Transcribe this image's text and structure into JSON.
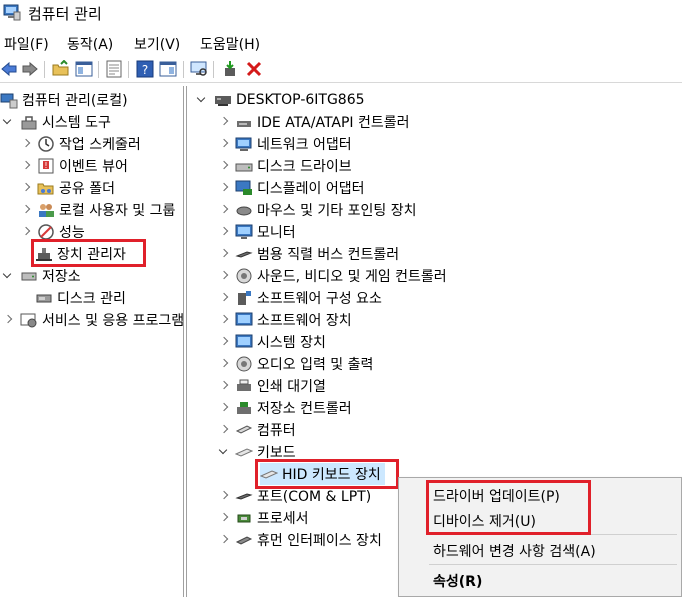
{
  "window": {
    "title": "컴퓨터 관리"
  },
  "menu": [
    "파일(F)",
    "동작(A)",
    "보기(V)",
    "도움말(H)"
  ],
  "left_tree": {
    "root": "컴퓨터 관리(로컬)",
    "system_tools": "시스템 도구",
    "task_scheduler": "작업 스케줄러",
    "event_viewer": "이벤트 뷰어",
    "shared_folders": "공유 폴더",
    "local_users": "로컬 사용자 및 그룹",
    "performance": "성능",
    "device_manager": "장치 관리자",
    "storage": "저장소",
    "disk_management": "디스크 관리",
    "services": "서비스 및 응용 프로그램"
  },
  "device_tree": {
    "computer": "DESKTOP-6ITG865",
    "categories": [
      "IDE ATA/ATAPI 컨트롤러",
      "네트워크 어댑터",
      "디스크 드라이브",
      "디스플레이 어댑터",
      "마우스 및 기타 포인팅 장치",
      "모니터",
      "범용 직렬 버스 컨트롤러",
      "사운드, 비디오 및 게임 컨트롤러",
      "소프트웨어 구성 요소",
      "소프트웨어 장치",
      "시스템 장치",
      "오디오 입력 및 출력",
      "인쇄 대기열",
      "저장소 컨트롤러",
      "컴퓨터",
      "키보드"
    ],
    "keyboard_child": "HID 키보드 장치",
    "after": [
      "포트(COM & LPT)",
      "프로세서",
      "휴먼 인터페이스 장치"
    ]
  },
  "context_menu": {
    "update_driver": "드라이버 업데이트(P)",
    "uninstall": "디바이스 제거(U)",
    "scan": "하드웨어 변경 사항 검색(A)",
    "properties": "속성(R)"
  },
  "colors": {
    "highlight": "#e0202a",
    "selection": "#cce8ff",
    "menu_bg": "#f2f2f2"
  }
}
